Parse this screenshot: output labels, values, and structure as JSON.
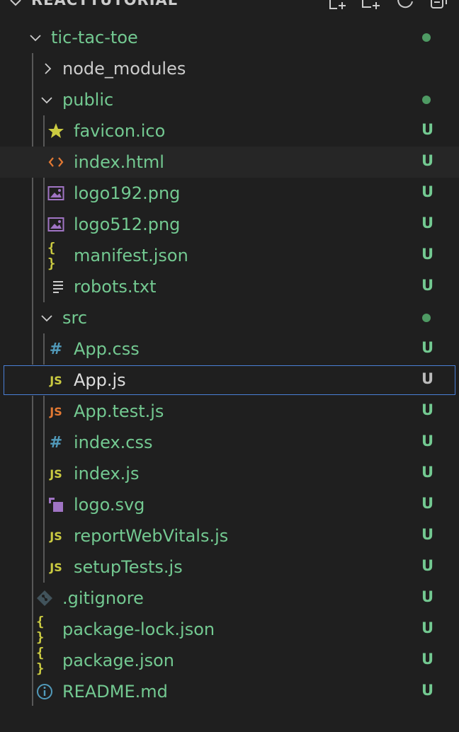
{
  "explorer": {
    "section_title": "REACTTUTORIAL",
    "section_icon": "chevron-down-icon",
    "actions": [
      {
        "name": "new-file-icon"
      },
      {
        "name": "new-folder-icon"
      },
      {
        "name": "refresh-icon"
      },
      {
        "name": "collapse-all-icon"
      }
    ]
  },
  "tree": [
    {
      "label": "tic-tac-toe",
      "type": "folder",
      "expanded": true,
      "status": "dot"
    },
    {
      "label": "node_modules",
      "type": "folder",
      "expanded": false,
      "status": ""
    },
    {
      "label": "public",
      "type": "folder",
      "expanded": true,
      "status": "dot"
    },
    {
      "label": "favicon.ico",
      "type": "file",
      "icon": "star-icon",
      "status": "U"
    },
    {
      "label": "index.html",
      "type": "file",
      "icon": "html-icon",
      "status": "U",
      "hover": true
    },
    {
      "label": "logo192.png",
      "type": "file",
      "icon": "image-icon",
      "status": "U"
    },
    {
      "label": "logo512.png",
      "type": "file",
      "icon": "image-icon",
      "status": "U"
    },
    {
      "label": "manifest.json",
      "type": "file",
      "icon": "json-icon",
      "status": "U"
    },
    {
      "label": "robots.txt",
      "type": "file",
      "icon": "text-file-icon",
      "status": "U"
    },
    {
      "label": "src",
      "type": "folder",
      "expanded": true,
      "status": "dot"
    },
    {
      "label": "App.css",
      "type": "file",
      "icon": "css-icon",
      "status": "U"
    },
    {
      "label": "App.js",
      "type": "file",
      "icon": "js-icon",
      "status": "U",
      "selected": true
    },
    {
      "label": "App.test.js",
      "type": "file",
      "icon": "js-test-icon",
      "status": "U"
    },
    {
      "label": "index.css",
      "type": "file",
      "icon": "css-icon",
      "status": "U"
    },
    {
      "label": "index.js",
      "type": "file",
      "icon": "js-icon",
      "status": "U"
    },
    {
      "label": "logo.svg",
      "type": "file",
      "icon": "svg-icon",
      "status": "U"
    },
    {
      "label": "reportWebVitals.js",
      "type": "file",
      "icon": "js-icon",
      "status": "U"
    },
    {
      "label": "setupTests.js",
      "type": "file",
      "icon": "js-icon",
      "status": "U"
    },
    {
      "label": ".gitignore",
      "type": "file",
      "icon": "git-icon",
      "status": "U"
    },
    {
      "label": "package-lock.json",
      "type": "file",
      "icon": "json-icon",
      "status": "U"
    },
    {
      "label": "package.json",
      "type": "file",
      "icon": "json-icon",
      "status": "U"
    },
    {
      "label": "README.md",
      "type": "file",
      "icon": "info-icon",
      "status": "U"
    }
  ],
  "glyphs": {
    "js": "JS",
    "hash": "#",
    "braces": "{ }",
    "html": "<>"
  },
  "colors": {
    "untracked": "#73c991",
    "selection_border": "#4a7fd6",
    "js": "#cbcb41",
    "js_test": "#e37933",
    "css": "#519aba",
    "image": "#a074c4",
    "html": "#e37933",
    "git": "#41535b",
    "info": "#519aba"
  }
}
